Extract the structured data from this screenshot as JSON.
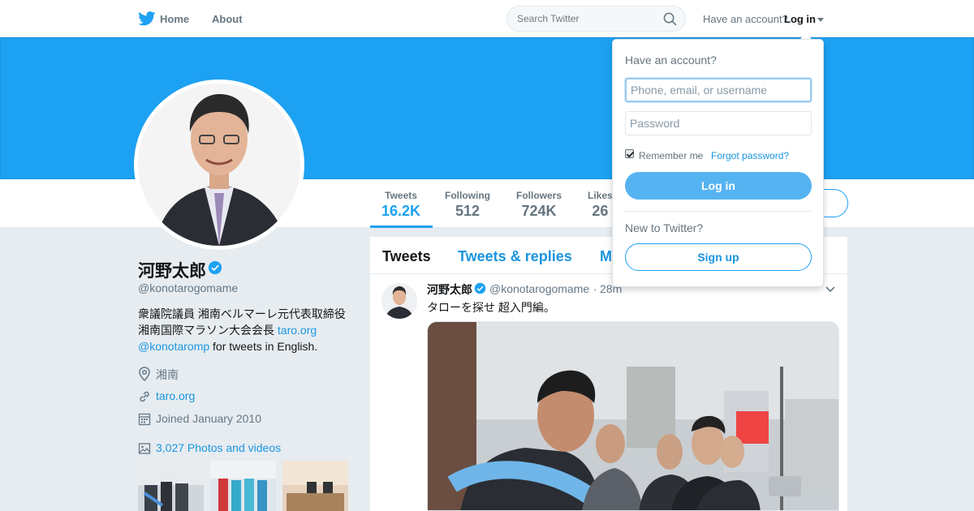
{
  "nav": {
    "home_label": "Home",
    "about_label": "About",
    "search_placeholder": "Search Twitter",
    "have_account": "Have an account?",
    "login_label": "Log in"
  },
  "profile": {
    "name": "河野太郎",
    "handle": "@konotarogomame",
    "bio_line1": "衆議院議員 湘南ベルマーレ元代表取締役",
    "bio_line2_text": "湘南国際マラソン大会会長 ",
    "bio_line2_link": "taro.org",
    "bio_line3_link": "@konotaromp",
    "bio_line3_text": " for tweets in English.",
    "location": "湘南",
    "url": "taro.org",
    "joined": "Joined January 2010",
    "photos_videos": "3,027 Photos and videos"
  },
  "stats": [
    {
      "label": "Tweets",
      "value": "16.2K"
    },
    {
      "label": "Following",
      "value": "512"
    },
    {
      "label": "Followers",
      "value": "724K"
    },
    {
      "label": "Likes",
      "value": "26"
    }
  ],
  "timeline": {
    "tabs": [
      "Tweets",
      "Tweets & replies",
      "M"
    ],
    "tweet": {
      "name": "河野太郎",
      "handle": "@konotarogomame",
      "separator": "·",
      "time": "28m",
      "text": "タローを探せ 超入門編。"
    }
  },
  "dropdown": {
    "heading": "Have an account?",
    "username_placeholder": "Phone, email, or username",
    "password_placeholder": "Password",
    "remember_label": "Remember me",
    "separator": "·",
    "forgot_label": "Forgot password?",
    "login_button": "Log in",
    "new_label": "New to Twitter?",
    "signup_button": "Sign up"
  },
  "colors": {
    "brand": "#1da1f2",
    "link": "#1b95e0",
    "background": "#e6ecf0"
  },
  "icons": [
    "twitter-bird-icon",
    "search-icon",
    "verified-icon",
    "location-icon",
    "link-icon",
    "calendar-icon",
    "photo-icon",
    "chevron-down-icon"
  ]
}
